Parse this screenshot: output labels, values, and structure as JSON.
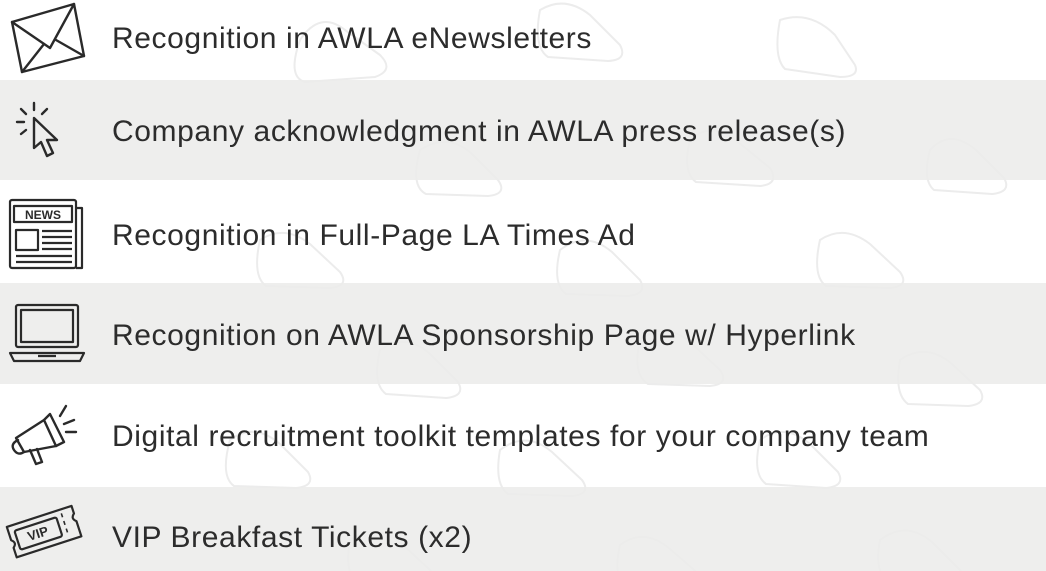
{
  "benefits": [
    {
      "label": "Recognition in AWLA eNewsletters",
      "icon": "envelope-icon",
      "shaded": false
    },
    {
      "label": "Company acknowledgment in AWLA press release(s)",
      "icon": "cursor-click-icon",
      "shaded": true
    },
    {
      "label": "Recognition in Full-Page LA Times Ad",
      "icon": "newspaper-icon",
      "shaded": false
    },
    {
      "label": "Recognition on AWLA Sponsorship Page w/ Hyperlink",
      "icon": "laptop-icon",
      "shaded": true
    },
    {
      "label": "Digital recruitment toolkit templates for your company team",
      "icon": "megaphone-icon",
      "shaded": false
    },
    {
      "label": "VIP Breakfast Tickets (x2)",
      "icon": "ticket-icon",
      "shaded": true
    }
  ],
  "newspaper_icon_text": "NEWS",
  "ticket_icon_text": "VIP",
  "colors": {
    "text": "#2c2c2c",
    "icon_stroke": "#2a2a2a",
    "row_shade": "#ececea",
    "pattern": "#ebebeb"
  }
}
